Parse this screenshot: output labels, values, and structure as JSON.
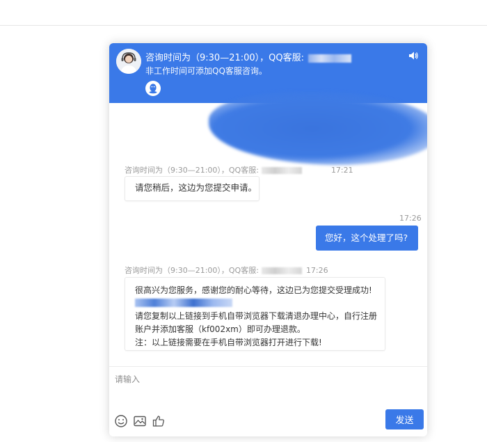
{
  "header": {
    "consult_hours": "咨询时间为（9:30—21:00），QQ客服:",
    "off_hours_note": "非工作时间可添加QQ客服咨询。",
    "icons": {
      "avatar": "agent-avatar",
      "qq": "qq-penguin-icon",
      "speaker": "speaker-icon"
    }
  },
  "messages": [
    {
      "side": "left",
      "meta_label": "咨询时间为（9:30—21:00），QQ客服:",
      "time": "17:21",
      "text": "请您稍后，这边为您提交申请。"
    },
    {
      "side": "right",
      "time": "17:26",
      "text": "您好，这个处理了吗?"
    },
    {
      "side": "left",
      "meta_label": "咨询时间为（9:30—21:00），QQ客服:",
      "time": "17:26",
      "lines": [
        "很高兴为您服务，感谢您的耐心等待，这边已为您提交受理成功!",
        "请您复制以上链接到手机自带浏览器下载清退办理中心，自行注册账户并添加客服（kf002xm）即可办理退款。",
        "注：以上链接需要在手机自带浏览器打开进行下载!"
      ]
    }
  ],
  "input": {
    "placeholder": "请输入"
  },
  "toolbar": {
    "icons": [
      "emoji-icon",
      "image-icon",
      "thumbs-up-icon"
    ],
    "send_label": "发送"
  },
  "colors": {
    "accent": "#3a79e8",
    "meta_text": "#9a9a9a"
  }
}
